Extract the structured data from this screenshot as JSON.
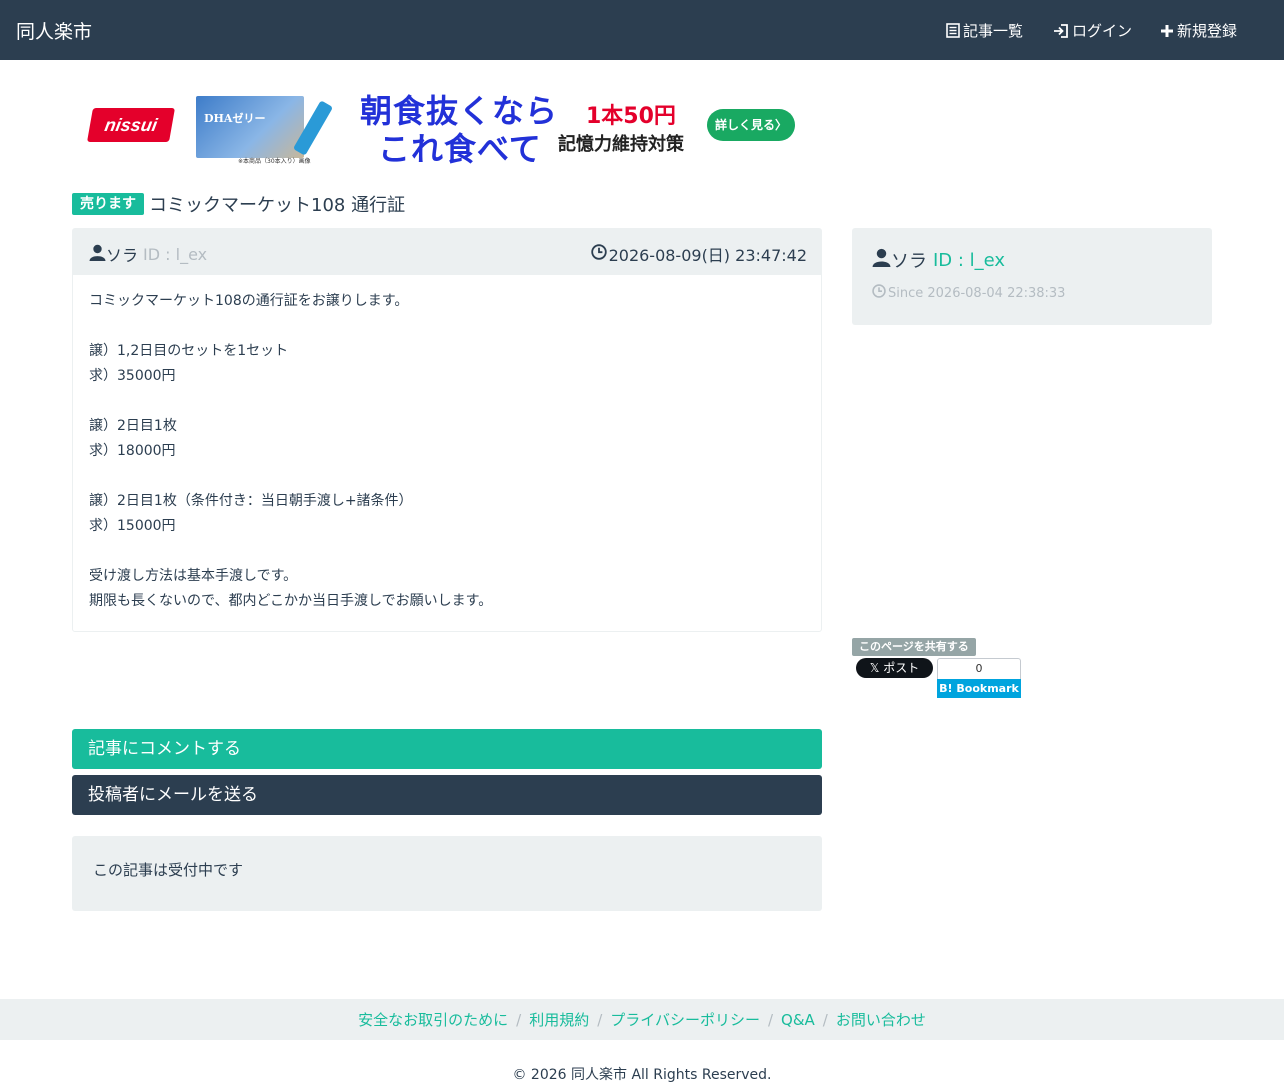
{
  "navbar": {
    "brand": "同人楽市",
    "items": [
      {
        "label": "記事一覧",
        "icon": "list-icon"
      },
      {
        "label": "ログイン",
        "icon": "login-icon"
      },
      {
        "label": "新規登録",
        "icon": "plus-icon"
      }
    ]
  },
  "ad": {
    "logo": "nissui",
    "product_label": "DHAゼリー",
    "note": "※本商品（30本入り）画像",
    "headline_1": "朝食抜くなら",
    "headline_2": "これ食べて",
    "price": "1本50円",
    "subline": "記憶力維持対策",
    "cta": "詳しく見る〉"
  },
  "post": {
    "badge": "売ります",
    "title": "コミックマーケット108 通行証",
    "author_name": "ソラ",
    "author_id": "ID : l_ex",
    "date": "2026-08-09(日) 23:47:42",
    "body_lines": [
      "コミックマーケット108の通行証をお譲りします。",
      "",
      "譲）1,2日目のセットを1セット",
      "求）35000円",
      "",
      "譲）2日目1枚",
      "求）18000円",
      "",
      "譲）2日目1枚（条件付き：当日朝手渡し+諸条件）",
      "求）15000円",
      "",
      "受け渡し方法は基本手渡しです。",
      "期限も長くないので、都内どこかか当日手渡しでお願いします。"
    ]
  },
  "user_card": {
    "name": "ソラ",
    "id": "ID : l_ex",
    "since": "Since 2026-08-04 22:38:33"
  },
  "share": {
    "label": "このページを共有する",
    "x_post": "𝕏 ポスト",
    "hatena_count": "0",
    "hatena_button": "B! Bookmark"
  },
  "actions": {
    "comment": "記事にコメントする",
    "mail": "投稿者にメールを送る"
  },
  "status": "この記事は受付中です",
  "footer": {
    "links": [
      "安全なお取引のために",
      "利用規約",
      "プライバシーポリシー",
      "Q&A",
      "お問い合わせ"
    ],
    "copyright": "© 2026 同人楽市 All Rights Reserved."
  },
  "colors": {
    "navbar": "#2c3e50",
    "accent": "#18bc9c",
    "panel": "#ecf0f1",
    "muted": "#b4bcc2"
  }
}
